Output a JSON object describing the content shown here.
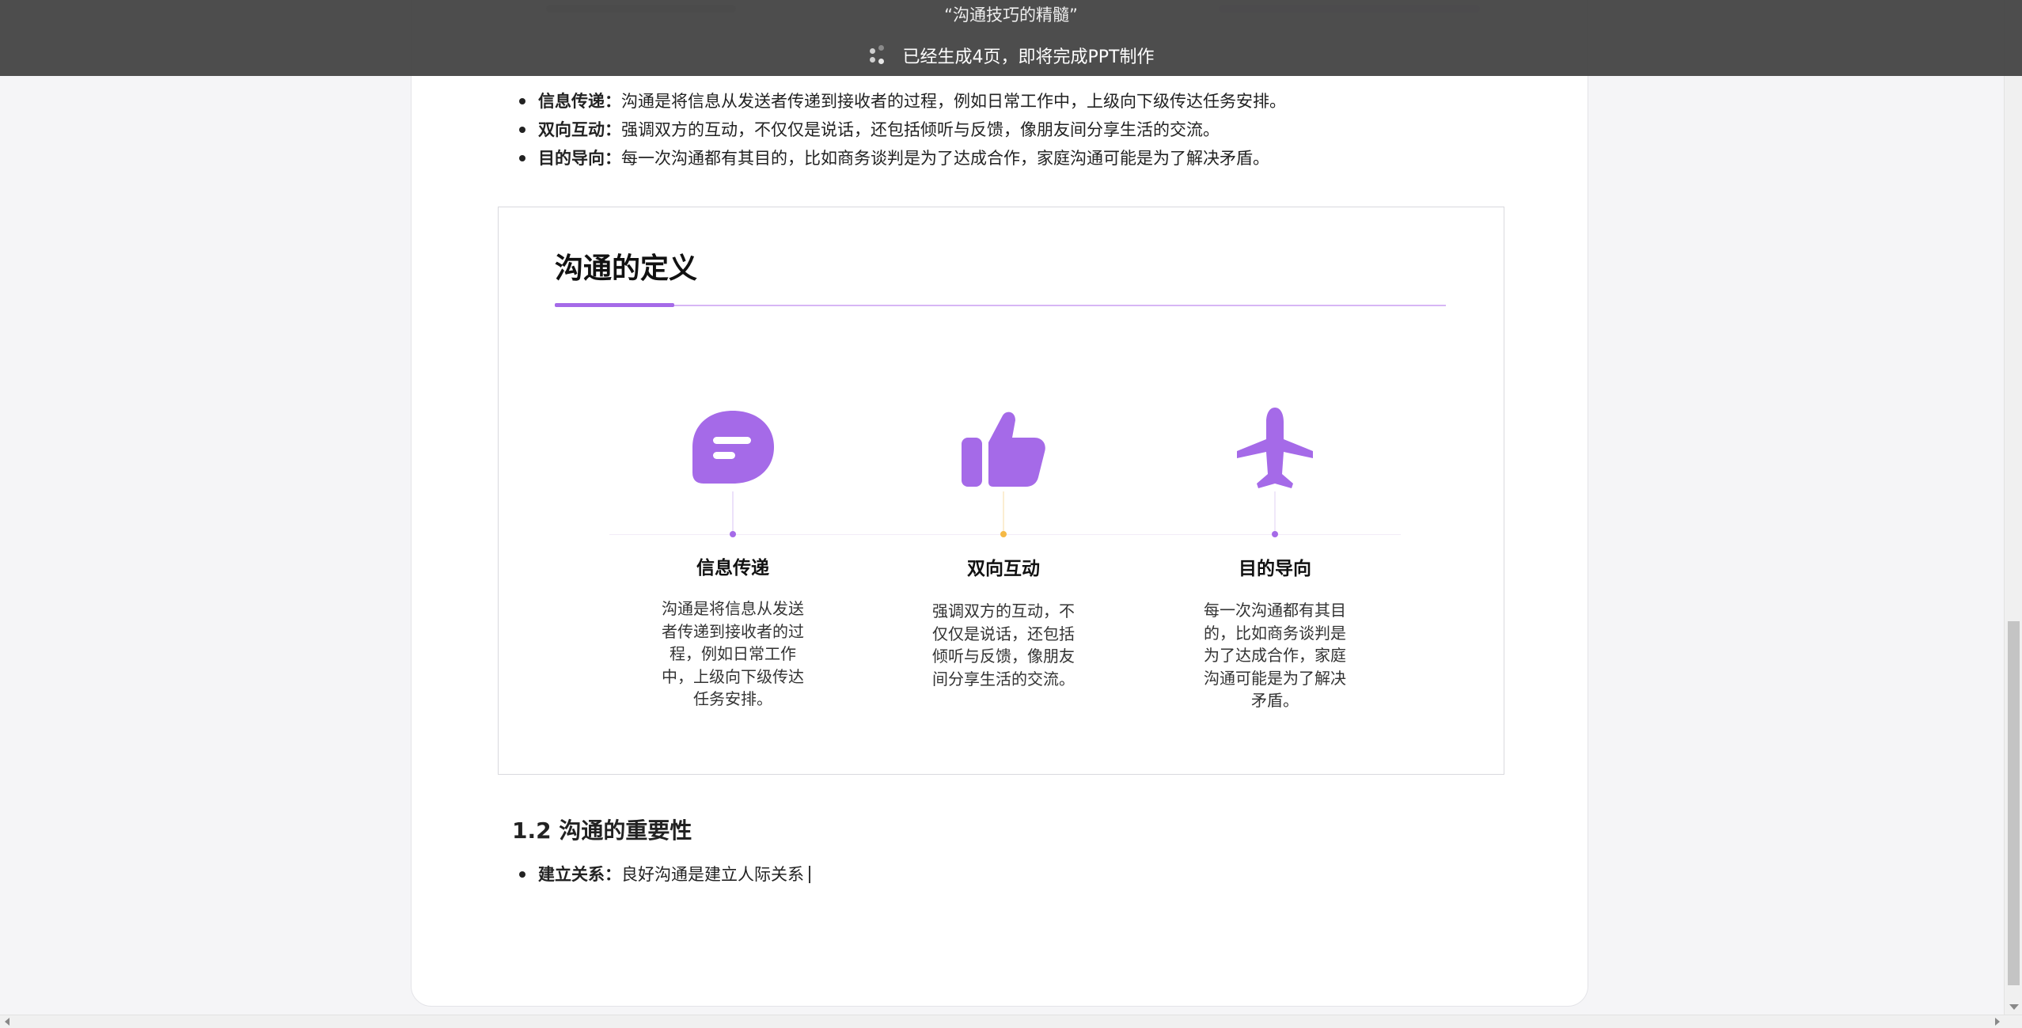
{
  "toast": {
    "title": "“沟通技巧的精髓”",
    "status": "已经生成4页，即将完成PPT制作",
    "icon": "loading-icon"
  },
  "doc": {
    "bullets_top": [
      {
        "term": "信息传递：",
        "text": "沟通是将信息从发送者传递到接收者的过程，例如日常工作中，上级向下级传达任务安排。"
      },
      {
        "term": "双向互动：",
        "text": "强调双方的互动，不仅仅是说话，还包括倾听与反馈，像朋友间分享生活的交流。"
      },
      {
        "term": "目的导向：",
        "text": "每一次沟通都有其目的，比如商务谈判是为了达成合作，家庭沟通可能是为了解决矛盾。"
      }
    ],
    "section_heading": "1.2 沟通的重要性",
    "bullets_bottom": [
      {
        "term": "建立关系：",
        "text": "良好沟通是建立人际关系"
      }
    ]
  },
  "slide": {
    "title": "沟通的定义",
    "accent_color": "#a56ae8",
    "features": [
      {
        "icon": "chat-bubble-icon",
        "title": "信息传递",
        "desc": "沟通是将信息从发送者传递到接收者的过程，例如日常工作中，上级向下级传达任务安排。",
        "dot_color": "#a56ae8"
      },
      {
        "icon": "thumbs-up-icon",
        "title": "双向互动",
        "desc": "强调双方的互动，不仅仅是说话，还包括倾听与反馈，像朋友间分享生活的交流。",
        "dot_color": "#f5b945"
      },
      {
        "icon": "airplane-icon",
        "title": "目的导向",
        "desc": "每一次沟通都有其目的，比如商务谈判是为了达成合作，家庭沟通可能是为了解决矛盾。",
        "dot_color": "#a56ae8"
      }
    ]
  }
}
